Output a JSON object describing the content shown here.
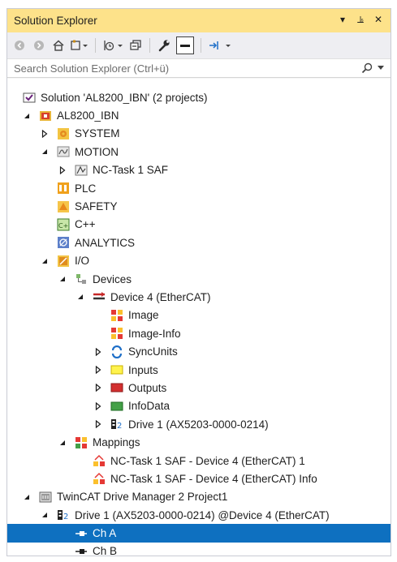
{
  "window": {
    "title": "Solution Explorer",
    "buttons": [
      "▾",
      "⫡",
      "✕"
    ]
  },
  "search": {
    "placeholder": "Search Solution Explorer (Ctrl+ü)"
  },
  "tree": [
    {
      "label": "Solution 'AL8200_IBN' (2 projects)",
      "level": 0,
      "expander": "none",
      "icon": "solution-icon"
    },
    {
      "label": "AL8200_IBN",
      "level": 1,
      "expander": "expanded",
      "icon": "twincat-project-icon"
    },
    {
      "label": "SYSTEM",
      "level": 2,
      "expander": "collapsed",
      "icon": "system-icon"
    },
    {
      "label": "MOTION",
      "level": 2,
      "expander": "expanded",
      "icon": "motion-icon"
    },
    {
      "label": "NC-Task 1 SAF",
      "level": 3,
      "expander": "collapsed",
      "icon": "nc-task-icon"
    },
    {
      "label": "PLC",
      "level": 2,
      "expander": "none",
      "icon": "plc-icon"
    },
    {
      "label": "SAFETY",
      "level": 2,
      "expander": "none",
      "icon": "safety-icon"
    },
    {
      "label": "C++",
      "level": 2,
      "expander": "none",
      "icon": "cpp-icon"
    },
    {
      "label": "ANALYTICS",
      "level": 2,
      "expander": "none",
      "icon": "analytics-icon"
    },
    {
      "label": "I/O",
      "level": 2,
      "expander": "expanded",
      "icon": "io-icon"
    },
    {
      "label": "Devices",
      "level": 3,
      "expander": "expanded",
      "icon": "devices-icon"
    },
    {
      "label": "Device 4 (EtherCAT)",
      "level": 4,
      "expander": "expanded",
      "icon": "ethercat-device-icon"
    },
    {
      "label": "Image",
      "level": 5,
      "expander": "none",
      "icon": "image-icon"
    },
    {
      "label": "Image-Info",
      "level": 5,
      "expander": "none",
      "icon": "image-info-icon"
    },
    {
      "label": "SyncUnits",
      "level": 5,
      "expander": "collapsed",
      "icon": "syncunits-icon"
    },
    {
      "label": "Inputs",
      "level": 5,
      "expander": "collapsed",
      "icon": "inputs-icon"
    },
    {
      "label": "Outputs",
      "level": 5,
      "expander": "collapsed",
      "icon": "outputs-icon"
    },
    {
      "label": "InfoData",
      "level": 5,
      "expander": "collapsed",
      "icon": "infodata-icon"
    },
    {
      "label": "Drive 1 (AX5203-0000-0214)",
      "level": 5,
      "expander": "collapsed",
      "icon": "drive-icon"
    },
    {
      "label": "Mappings",
      "level": 3,
      "expander": "expanded",
      "icon": "mappings-icon"
    },
    {
      "label": "NC-Task 1 SAF - Device 4 (EtherCAT) 1",
      "level": 4,
      "expander": "none",
      "icon": "mapping-icon"
    },
    {
      "label": "NC-Task 1 SAF - Device 4 (EtherCAT) Info",
      "level": 4,
      "expander": "none",
      "icon": "mapping-icon"
    },
    {
      "label": "TwinCAT Drive Manager 2 Project1",
      "level": 1,
      "expander": "expanded",
      "icon": "drive-manager-icon"
    },
    {
      "label": "Drive 1 (AX5203-0000-0214) @Device 4 (EtherCAT)",
      "level": 2,
      "expander": "expanded",
      "icon": "drive-icon"
    },
    {
      "label": "Ch A",
      "level": 3,
      "expander": "none",
      "icon": "channel-icon",
      "selected": true
    },
    {
      "label": "Ch B",
      "level": 3,
      "expander": "none",
      "icon": "channel-icon"
    }
  ],
  "colors": {
    "title_bg": "#fde28a",
    "selection": "#0e70c0"
  }
}
